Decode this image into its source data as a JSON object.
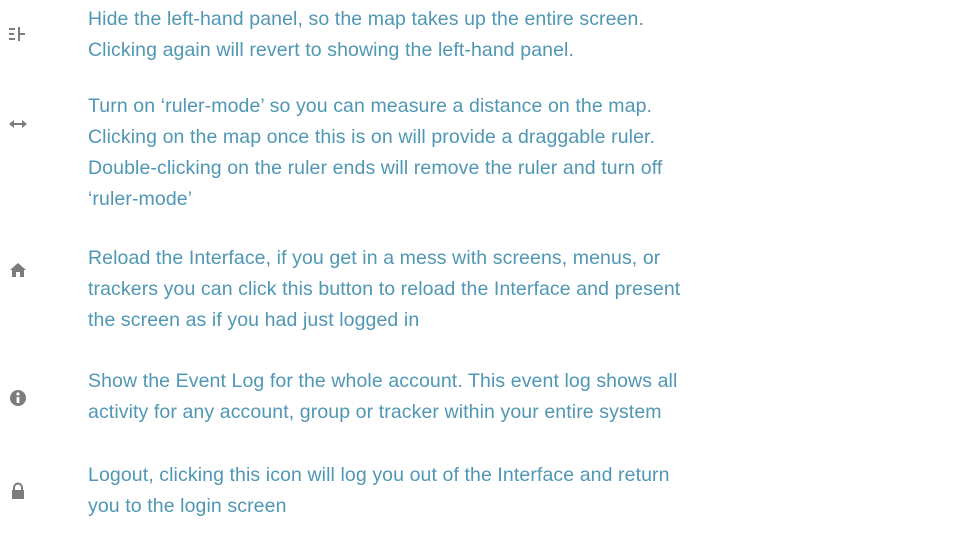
{
  "help_items": [
    {
      "icon": "hide-panel-icon",
      "lines": [
        "Hide the left-hand panel, so the map takes up the entire screen.",
        "Clicking again will revert to showing the left-hand panel."
      ]
    },
    {
      "icon": "ruler-icon",
      "lines": [
        "Turn on ‘ruler-mode’ so you can measure a distance on the map.",
        "Clicking on the map once this is on will provide a draggable ruler.",
        "Double-clicking on the ruler ends will remove the ruler and turn off",
        "‘ruler-mode’"
      ]
    },
    {
      "icon": "home-icon",
      "lines": [
        "Reload the Interface, if you get in a mess with screens, menus, or",
        "trackers you can click this button to reload the Interface and present",
        "the screen as if you had just logged in"
      ]
    },
    {
      "icon": "info-icon",
      "lines": [
        "Show the Event Log for the whole account. This event log shows all",
        "activity for any account, group or tracker within your entire system"
      ]
    },
    {
      "icon": "lock-icon",
      "lines": [
        "Logout, clicking this icon will log you out of the Interface and return",
        "you to the login screen"
      ]
    }
  ],
  "colors": {
    "text": "#4f97b4",
    "icon": "#7c7c7c",
    "background": "#ffffff"
  }
}
